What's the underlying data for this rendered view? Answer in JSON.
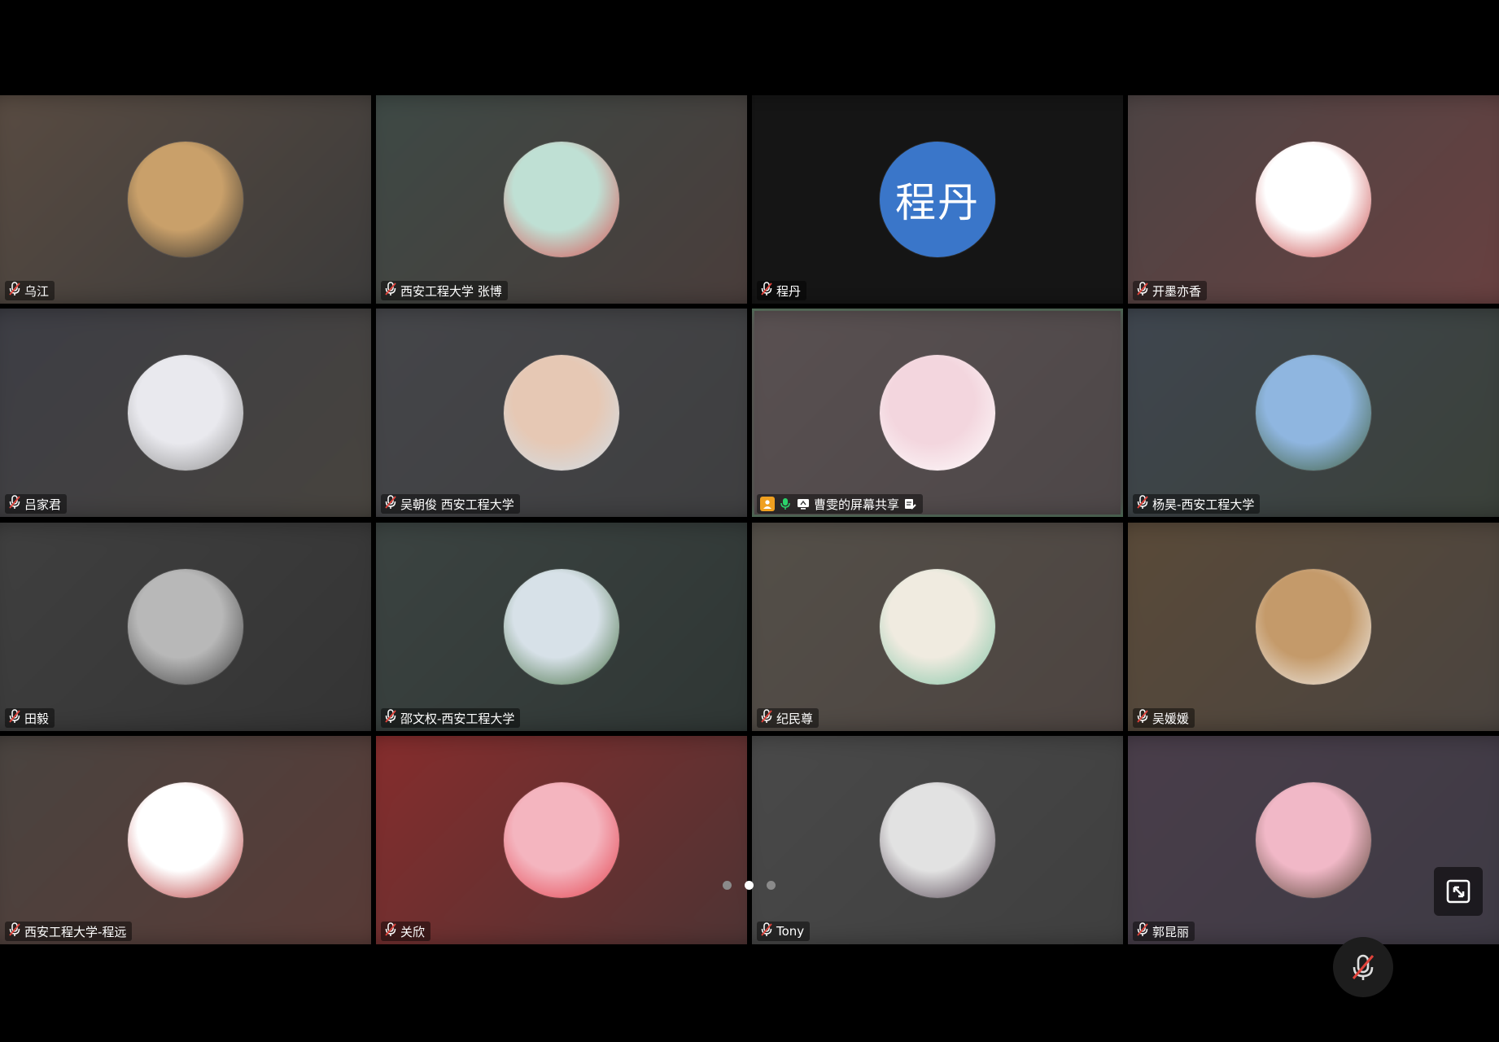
{
  "participants": [
    {
      "name": "乌江",
      "avatar": "penguin-avatar",
      "bg": [
        "#5a4c42",
        "#3a3a3a"
      ],
      "avatar_colors": [
        "#c9a06a",
        "#2a2a2a"
      ]
    },
    {
      "name": "西安工程大学 张博",
      "avatar": "cartoon-boy-avatar",
      "bg": [
        "#3d4a46",
        "#4a3c3a"
      ],
      "avatar_colors": [
        "#bfe0d4",
        "#d94b4b"
      ]
    },
    {
      "name": "程丹",
      "avatar": "initials-avatar",
      "initials": "程丹",
      "bg": [
        "#151515",
        "#151515"
      ],
      "avatar_colors": [
        "#3a76c9",
        "#3a76c9"
      ]
    },
    {
      "name": "开墨亦香",
      "avatar": "family-cartoon-avatar",
      "bg": [
        "#4b4444",
        "#6a4040"
      ],
      "avatar_colors": [
        "#ffffff",
        "#c33a3a"
      ]
    },
    {
      "name": "吕家君",
      "avatar": "white-bunny-avatar",
      "bg": [
        "#3c3d45",
        "#48443e"
      ],
      "avatar_colors": [
        "#e9e9ee",
        "#8a8a8a"
      ]
    },
    {
      "name": "吴朝俊 西安工程大学",
      "avatar": "children-photo-avatar",
      "bg": [
        "#45464a",
        "#3e3e3f"
      ],
      "avatar_colors": [
        "#e6c8b4",
        "#cfe0ec"
      ]
    },
    {
      "name": "曹雯的屏幕共享",
      "avatar": "family-drawing-avatar",
      "bg": [
        "#5a5152",
        "#4c4647"
      ],
      "avatar_colors": [
        "#f3d6de",
        "#ffffff"
      ],
      "active": true,
      "screen_share": true
    },
    {
      "name": "杨昊-西安工程大学",
      "avatar": "mountain-photo-avatar",
      "bg": [
        "#3f4650",
        "#3a4038"
      ],
      "avatar_colors": [
        "#8fb6e0",
        "#3c5a34"
      ]
    },
    {
      "name": "田毅",
      "avatar": "portrait-photo-avatar",
      "bg": [
        "#404040",
        "#333333"
      ],
      "avatar_colors": [
        "#b8b8b8",
        "#3a3a3a"
      ]
    },
    {
      "name": "邵文权-西安工程大学",
      "avatar": "forest-photo-avatar",
      "bg": [
        "#3c4442",
        "#2e3533"
      ],
      "avatar_colors": [
        "#d7e1e8",
        "#3f6a3c"
      ]
    },
    {
      "name": "纪民尊",
      "avatar": "cat-illustration-avatar",
      "bg": [
        "#545049",
        "#4c4340"
      ],
      "avatar_colors": [
        "#f0ebe0",
        "#7cc3a4"
      ]
    },
    {
      "name": "吴媛媛",
      "avatar": "coffee-photo-avatar",
      "bg": [
        "#5a4a38",
        "#4a4440"
      ],
      "avatar_colors": [
        "#c49a6a",
        "#f2f2f2"
      ]
    },
    {
      "name": "西安工程大学-程远",
      "avatar": "cartoon-man-avatar",
      "bg": [
        "#484440",
        "#5a3a36"
      ],
      "avatar_colors": [
        "#ffffff",
        "#b32b2b"
      ]
    },
    {
      "name": "关欣",
      "avatar": "pomegranate-cartoon-avatar",
      "bg": [
        "#8a2c2c",
        "#4a3434"
      ],
      "avatar_colors": [
        "#f4b5bf",
        "#e33b47"
      ]
    },
    {
      "name": "Tony",
      "avatar": "dancers-photo-avatar",
      "bg": [
        "#4a4a4a",
        "#3e3e3e"
      ],
      "avatar_colors": [
        "#e2e2e2",
        "#4a3a48"
      ]
    },
    {
      "name": "郭昆丽",
      "avatar": "flowers-photo-avatar",
      "bg": [
        "#4a3e4a",
        "#3d3a44"
      ],
      "avatar_colors": [
        "#f1b8c7",
        "#4a3a2a"
      ]
    }
  ],
  "pager": {
    "pages": 3,
    "current": 2
  },
  "icons": {
    "tile_mic": "mic-icon",
    "host": "host-icon",
    "speaking_mic": "mic-active-icon",
    "screen": "screen-share-icon",
    "doc": "doc-edit-icon",
    "expand": "expand-icon",
    "mute": "mic-muted-icon"
  },
  "colors": {
    "active_border": "#2bd46b",
    "accent_orange": "#f0a020",
    "mic_green": "#2bd46b",
    "muted_red": "#e0433b"
  }
}
